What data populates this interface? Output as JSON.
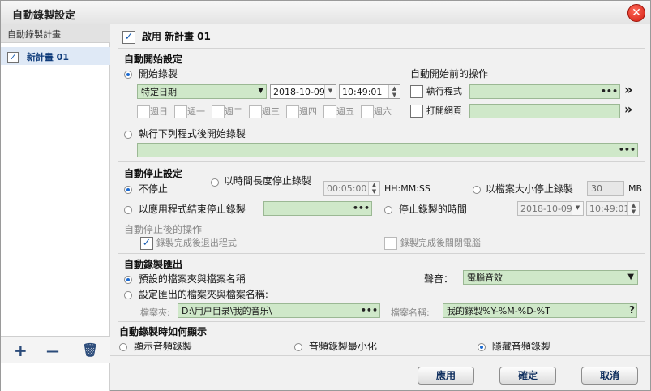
{
  "window": {
    "title": "自動錄製設定",
    "close_glyph": "✕"
  },
  "sidebar": {
    "header": "自動錄製計畫",
    "item": {
      "label": "新計畫 01",
      "checked": true
    },
    "add_icon": "+",
    "remove_icon": "—",
    "delete_icon": "🗑"
  },
  "enable_plan": {
    "label": "啟用 新計畫 01",
    "checked": true
  },
  "auto_start": {
    "title": "自動開始設定",
    "start_recording": {
      "label": "開始錄製",
      "selected": true
    },
    "mode": "特定日期",
    "date": "2018-10-09",
    "time": "10:49:01",
    "weekdays": [
      "週日",
      "週一",
      "週二",
      "週三",
      "週四",
      "週五",
      "週六"
    ],
    "after_program": {
      "label": "執行下列程式後開始錄製",
      "selected": false
    },
    "before_title": "自動開始前的操作",
    "run_program": {
      "label": "執行程式",
      "checked": false,
      "dots": "•••",
      "arrow": "»"
    },
    "open_page": {
      "label": "打開網頁",
      "checked": false,
      "arrow": "»"
    },
    "program_dots": "•••"
  },
  "auto_stop": {
    "title": "自動停止設定",
    "no_stop": {
      "label": "不停止",
      "selected": true
    },
    "by_duration": {
      "label": "以時間長度停止錄製",
      "selected": false,
      "value": "00:05:00",
      "unit": "HH:MM:SS"
    },
    "by_size": {
      "label": "以檔案大小停止錄製",
      "selected": false,
      "value": "30",
      "unit": "MB"
    },
    "by_app_end": {
      "label": "以應用程式結束停止錄製",
      "selected": false,
      "dots": "•••"
    },
    "stop_time": {
      "label": "停止錄製的時間",
      "selected": false,
      "date": "2018-10-09",
      "time": "10:49:01"
    },
    "after_title": "自動停止後的操作",
    "exit_program": {
      "label": "錄製完成後退出程式",
      "checked": true
    },
    "shutdown": {
      "label": "錄製完成後關閉電腦",
      "checked": false
    }
  },
  "export": {
    "title": "自動錄製匯出",
    "default_folder": {
      "label": "預設的檔案夾與檔案名稱",
      "selected": true
    },
    "custom_folder": {
      "label": "設定匯出的檔案夾與檔案名稱:",
      "selected": false
    },
    "sound_label": "聲音：",
    "sound_value": "電腦音效",
    "folder_label": "檔案夾:",
    "folder_value": "D:\\用户目录\\我的音乐\\",
    "folder_dots": "•••",
    "filename_label": "檔案名稱:",
    "filename_value": "我的錄製%Y-%M-%D-%T",
    "help": "?"
  },
  "display": {
    "title": "自動錄製時如何顯示",
    "show": {
      "label": "顯示音頻錄製",
      "selected": false
    },
    "minimize": {
      "label": "音頻錄製最小化",
      "selected": false
    },
    "hide": {
      "label": "隱藏音頻錄製",
      "selected": true
    }
  },
  "buttons": {
    "apply": "應用",
    "ok": "確定",
    "cancel": "取消"
  }
}
